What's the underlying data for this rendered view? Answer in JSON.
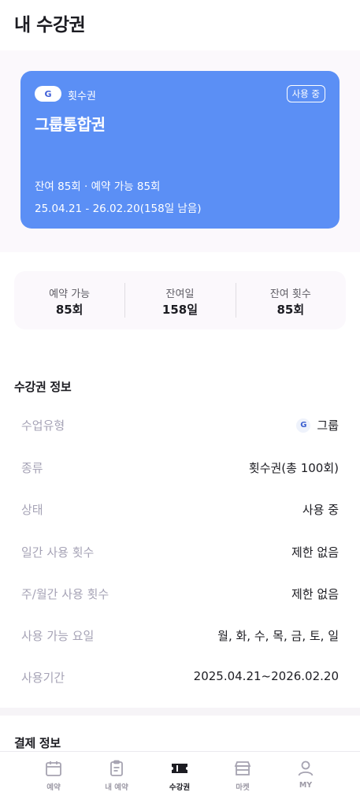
{
  "header": {
    "title": "내 수강권"
  },
  "ticket": {
    "badge": "G",
    "kind": "횟수권",
    "status": "사용 중",
    "name": "그룹통합권",
    "remaining": "잔여 85회 · 예약 가능 85회",
    "period": "25.04.21 - 26.02.20(158일 남음)",
    "color": "#5b8ff5"
  },
  "stats": [
    {
      "label": "예약 가능",
      "value": "85회"
    },
    {
      "label": "잔여일",
      "value": "158일"
    },
    {
      "label": "잔여 횟수",
      "value": "85회"
    }
  ],
  "info_section": {
    "title": "수강권 정보",
    "rows": [
      {
        "label": "수업유형",
        "value": "그룹",
        "badge": "G"
      },
      {
        "label": "종류",
        "value": "횟수권(총 100회)"
      },
      {
        "label": "상태",
        "value": "사용 중"
      },
      {
        "label": "일간 사용 횟수",
        "value": "제한 없음"
      },
      {
        "label": "주/월간 사용 횟수",
        "value": "제한 없음"
      },
      {
        "label": "사용 가능 요일",
        "value": "월, 화, 수, 목, 금, 토, 일"
      },
      {
        "label": "사용기간",
        "value": "2025.04.21~2026.02.20"
      }
    ]
  },
  "payment_section": {
    "title": "결제 정보"
  },
  "bottom_nav": [
    {
      "label": "예약",
      "icon": "calendar-icon",
      "active": false
    },
    {
      "label": "내 예약",
      "icon": "clipboard-icon",
      "active": false
    },
    {
      "label": "수강권",
      "icon": "ticket-icon",
      "active": true
    },
    {
      "label": "마켓",
      "icon": "store-icon",
      "active": false
    },
    {
      "label": "MY",
      "icon": "user-icon",
      "active": false
    }
  ]
}
